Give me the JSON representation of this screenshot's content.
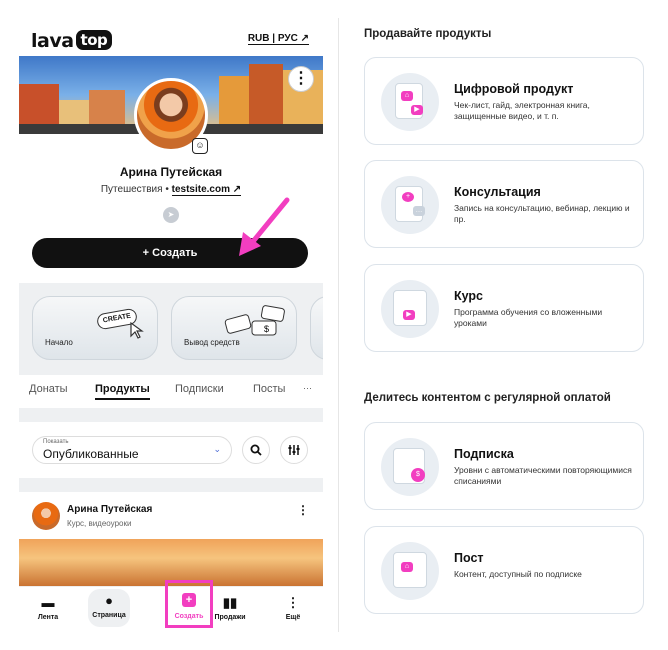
{
  "brand": {
    "logo_main": "lava",
    "logo_badge": "top",
    "lang_switch": "RUB | РУС ↗"
  },
  "profile": {
    "name": "Арина Путейская",
    "tagline_prefix": "Путешествия • ",
    "site": "testsite.com ↗",
    "telegram_icon": "telegram-icon",
    "more": "⋮"
  },
  "actions": {
    "create_label": "+ Создать"
  },
  "quick_cards": [
    {
      "label": "Начало",
      "tag": "CREATE"
    },
    {
      "label": "Вывод средств"
    }
  ],
  "tabs": [
    "Донаты",
    "Продукты",
    "Подписки",
    "Посты",
    "···"
  ],
  "active_tab": "Продукты",
  "filter": {
    "caption": "Показать",
    "value": "Опубликованные"
  },
  "post": {
    "author": "Арина Путейская",
    "subtitle": "Курс, видеоуроки",
    "more": "⋮"
  },
  "bottom_nav": [
    {
      "label": "Лента",
      "icon": "feed-icon"
    },
    {
      "label": "Страница",
      "icon": "user-icon"
    },
    {
      "label": "Создать",
      "icon": "plus-icon"
    },
    {
      "label": "Продажи",
      "icon": "chart-icon"
    },
    {
      "label": "Ещё",
      "icon": "more-icon"
    }
  ],
  "sections": {
    "sell_title": "Продавайте продукты",
    "sub_title": "Делитесь контентом с регулярной оплатой"
  },
  "products": [
    {
      "title": "Цифровой продукт",
      "desc": "Чек-лист, гайд, электронная книга, защищенные видео, и т. п."
    },
    {
      "title": "Консультация",
      "desc": "Запись на консультацию, вебинар, лекцию и пр."
    },
    {
      "title": "Курс",
      "desc": "Программа обучения со вложенными уроками"
    }
  ],
  "recurring": [
    {
      "title": "Подписка",
      "desc": "Уровни с автоматическими повторяющимися списаниями"
    },
    {
      "title": "Пост",
      "desc": "Контент, доступный по подписке"
    }
  ],
  "colors": {
    "accent": "#f23ec0",
    "dark": "#111111",
    "card_border": "#dce3ea"
  }
}
